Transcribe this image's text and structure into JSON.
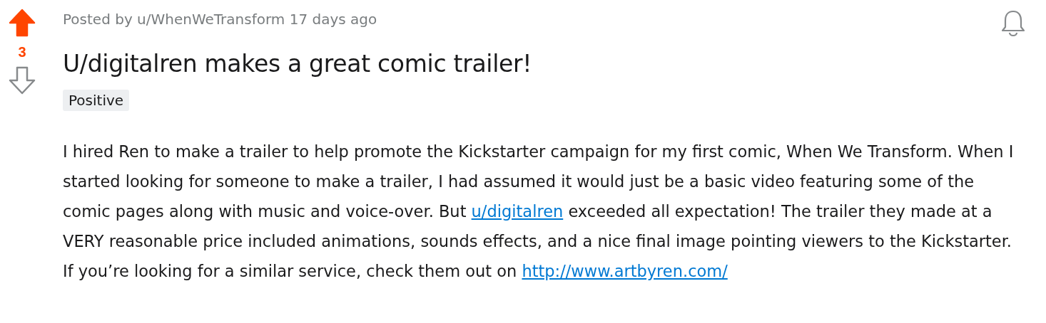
{
  "vote": {
    "score": "3",
    "upvoted": true,
    "downvoted": false
  },
  "post": {
    "byline": "Posted by u/WhenWeTransform 17 days ago",
    "title": "U/digitalren makes a great comic trailer!",
    "flair": "Positive",
    "body": [
      {
        "kind": "text",
        "text": "I hired Ren to make a trailer to help promote the Kickstarter campaign for my first comic, When We Transform. When I started looking for someone to make a trailer, I had assumed it would just be a basic video featuring some of the comic pages along with music and voice-over. But "
      },
      {
        "kind": "link",
        "text": "u/digitalren"
      },
      {
        "kind": "text",
        "text": " exceeded all expectation! The trailer they made at a VERY reasonable price included animations, sounds effects, and a nice final image pointing viewers to the Kickstarter. If you’re looking for a similar service, check them out on "
      },
      {
        "kind": "link",
        "text": "http://www.artbyren.com/"
      }
    ]
  },
  "notifications": {
    "on": false
  }
}
